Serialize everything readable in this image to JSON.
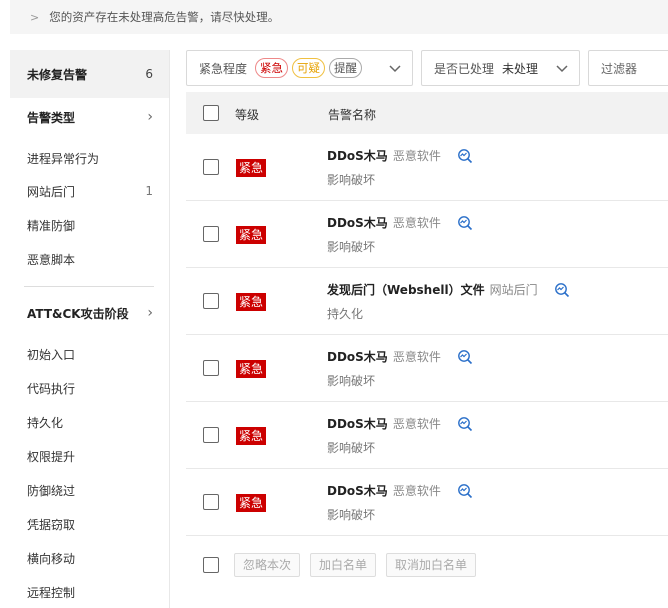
{
  "notice": {
    "text": "您的资产存在未处理高危告警，请尽快处理。"
  },
  "sidebar": {
    "head": {
      "title": "未修复告警",
      "count": "6"
    },
    "section_type": "告警类型",
    "type_items": [
      {
        "label": "进程异常行为",
        "count": ""
      },
      {
        "label": "网站后门",
        "count": "1"
      },
      {
        "label": "精准防御",
        "count": ""
      },
      {
        "label": "恶意脚本",
        "count": ""
      }
    ],
    "section_attck": "ATT&CK攻击阶段",
    "attck_items": [
      {
        "label": "初始入口"
      },
      {
        "label": "代码执行"
      },
      {
        "label": "持久化"
      },
      {
        "label": "权限提升"
      },
      {
        "label": "防御绕过"
      },
      {
        "label": "凭据窃取"
      },
      {
        "label": "横向移动"
      },
      {
        "label": "远程控制"
      }
    ]
  },
  "filters": {
    "severity_label": "紧急程度",
    "tags": [
      "紧急",
      "可疑",
      "提醒"
    ],
    "handled_label": "是否已处理",
    "handled_value": "未处理",
    "filter_placeholder": "过滤器"
  },
  "table": {
    "col_level": "等级",
    "col_name": "告警名称",
    "rows": [
      {
        "level": "紧急",
        "name": "DDoS木马",
        "category": "恶意软件",
        "impact": "影响破坏"
      },
      {
        "level": "紧急",
        "name": "DDoS木马",
        "category": "恶意软件",
        "impact": "影响破坏"
      },
      {
        "level": "紧急",
        "name": "发现后门（Webshell）文件",
        "category": "网站后门",
        "impact": "持久化"
      },
      {
        "level": "紧急",
        "name": "DDoS木马",
        "category": "恶意软件",
        "impact": "影响破坏"
      },
      {
        "level": "紧急",
        "name": "DDoS木马",
        "category": "恶意软件",
        "impact": "影响破坏"
      },
      {
        "level": "紧急",
        "name": "DDoS木马",
        "category": "恶意软件",
        "impact": "影响破坏"
      }
    ]
  },
  "footer": {
    "ignore": "忽略本次",
    "whitelist": "加白名单",
    "cancel_whitelist": "取消加白名单"
  },
  "colors": {
    "urgent": "#cc0000",
    "suspicious": "#e6a100",
    "icon": "#2a6fc9"
  },
  "icons": {
    "row_action": "trend-search-icon",
    "chevron_right": "chevron-right-icon",
    "chevron_down": "chevron-down-icon"
  }
}
